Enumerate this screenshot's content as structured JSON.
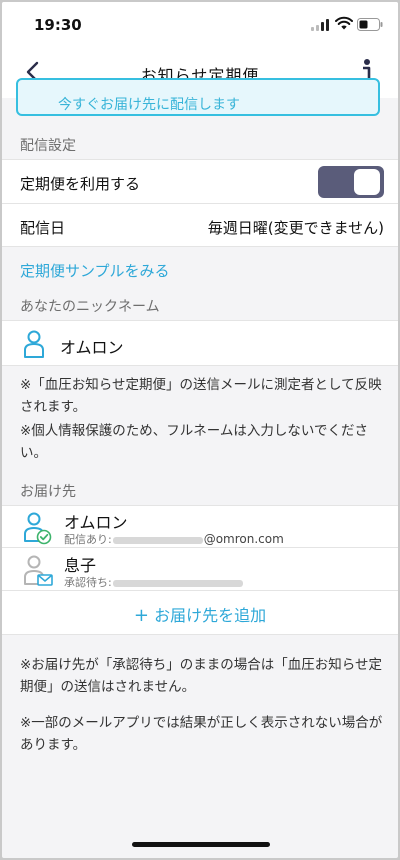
{
  "status": {
    "time": "19:30"
  },
  "nav": {
    "title": "お知らせ定期便"
  },
  "banner": {
    "text": "今すぐお届け先に配信します"
  },
  "delivery": {
    "section_label": "配信設定",
    "use_label": "定期便を利用する",
    "use_enabled": true,
    "day_label": "配信日",
    "day_value": "毎週日曜(変更できません)"
  },
  "sample_link": "定期便サンプルをみる",
  "nickname": {
    "section_label": "あなたのニックネーム",
    "value": "オムロン",
    "note1": "※「血圧お知らせ定期便」の送信メールに測定者として反映されます。",
    "note2": "※個人情報保護のため、フルネームは入力しないでください。"
  },
  "recipients": {
    "section_label": "お届け先",
    "items": [
      {
        "name": "オムロン",
        "status": "配信あり:",
        "email_domain": "@omron.com"
      },
      {
        "name": "息子",
        "status": "承認待ち:",
        "email_domain": ""
      }
    ],
    "add_label": "お届け先を追加"
  },
  "footer_notes": {
    "note1": "※お届け先が「承認待ち」のままの場合は「血圧お知らせ定期便」の送信はされません。",
    "note2": "※一部のメールアプリでは結果が正しく表示されない場合があります。"
  },
  "colors": {
    "accent": "#2ea8d8",
    "toggle": "#5a5c7a",
    "green_check": "#3db36b"
  }
}
